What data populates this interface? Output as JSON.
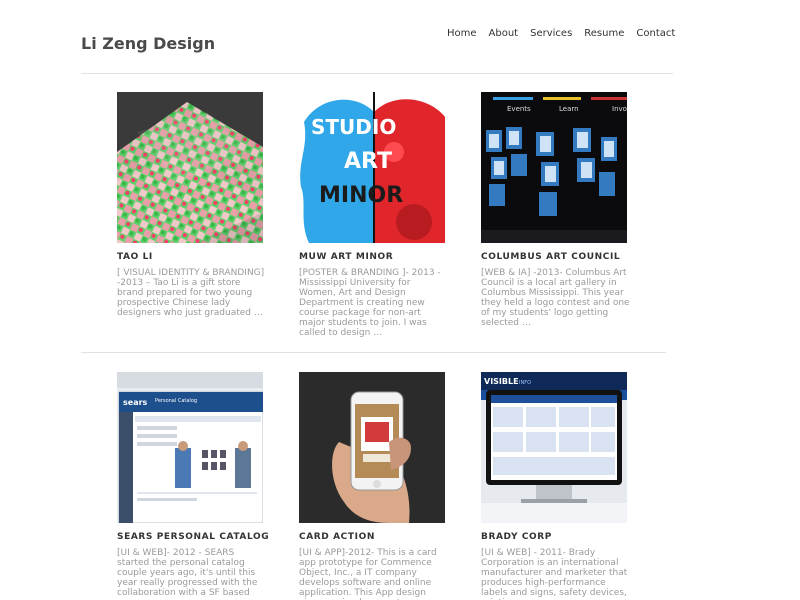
{
  "header": {
    "site_title": "Li Zeng Design",
    "nav": [
      "Home",
      "About",
      "Services",
      "Resume",
      "Contact"
    ]
  },
  "projects": [
    {
      "title": "TAO LI",
      "description": "[ VISUAL IDENTITY & BRANDING] -2013 – Tao Li is a gift store brand prepared for two young prospective Chinese lady designers who just graduated …"
    },
    {
      "title": "MUW ART MINOR",
      "description": "[POSTER & BRANDING ]- 2013 - Mississippi University for Women, Art and Design Department is creating new course package for non-art major students to join. I was called to design …"
    },
    {
      "title": "COLUMBUS ART COUNCIL",
      "description": "[WEB & IA] -2013- Columbus Art Council is a local art gallery in Columbus Mississippi. This year they held a logo contest and one of my students' logo getting selected …"
    },
    {
      "title": "SEARS PERSONAL CATALOG",
      "description": "[UI & WEB]- 2012 - SEARS started the personal catalog couple years ago, it's until this year really progressed with the collaboration with a SF based"
    },
    {
      "title": "CARD ACTION",
      "description": "[UI & APP]-2012- This is a card app prototype for Commence Object, Inc., a IT company develops software and online application. This App design aims on simple, easy to"
    },
    {
      "title": "BRADY CORP",
      "description": "[UI & WEB] - 2011- Brady Corporation is an international manufacturer and marketer that produces high-performance labels and signs, safety devices, printing"
    }
  ],
  "thumb_text": {
    "studio": "STUDIO",
    "art": "ART",
    "minor": "MINOR",
    "cac_tabs": [
      "Events",
      "Learn",
      "Invo"
    ],
    "sears_logo": "sears",
    "sears_header": "Personal Catalog",
    "brady_brand": "VISIBLE",
    "brady_sub": "INFO"
  },
  "colors": {
    "title": "#4a4a4a",
    "desc": "#9a9a9a",
    "rule": "#e2e2e2",
    "muw_blue": "#2fa7e8",
    "muw_red": "#e0262b"
  }
}
